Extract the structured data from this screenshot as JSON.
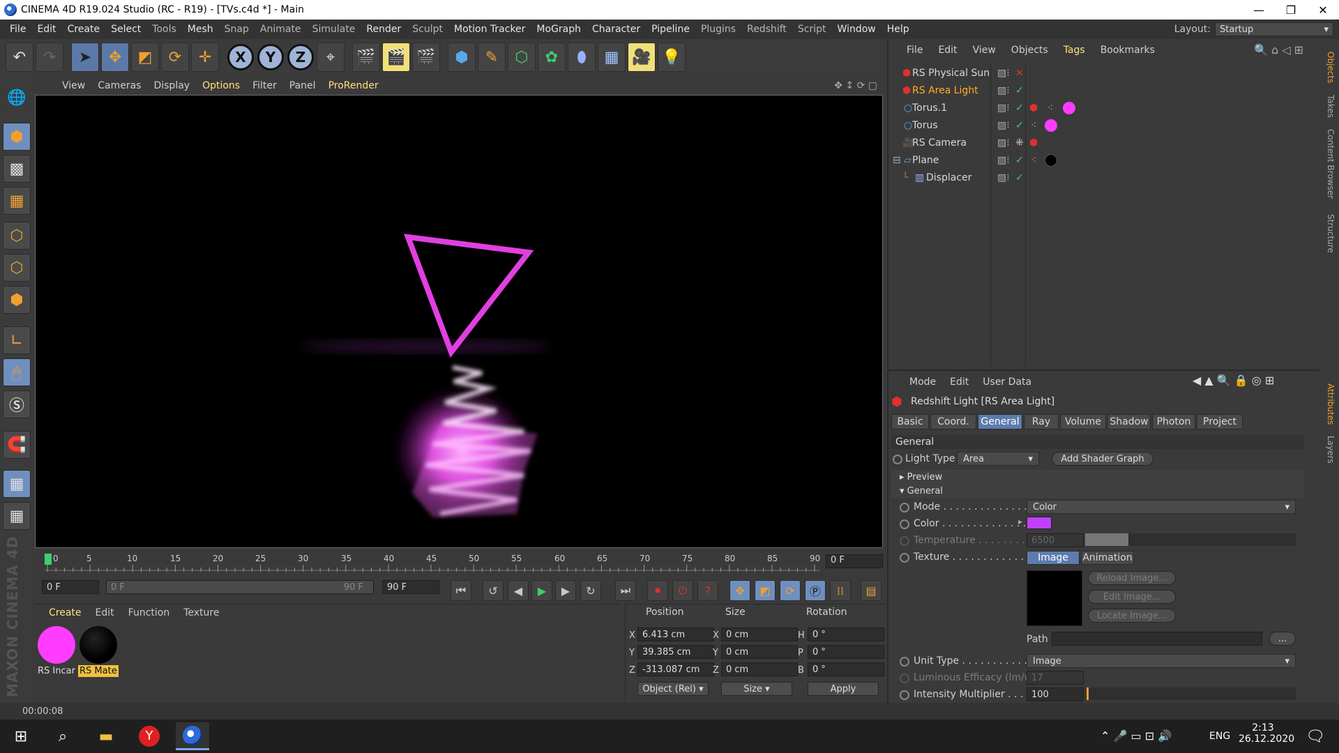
{
  "titlebar": {
    "title": "CINEMA 4D R19.024 Studio (RC - R19) - [TVs.c4d *] - Main",
    "minimize": "—",
    "restore": "❐",
    "close": "✕"
  },
  "menubar": {
    "items": [
      "File",
      "Edit",
      "Create",
      "Select",
      "Tools",
      "Mesh",
      "Snap",
      "Animate",
      "Simulate",
      "Render",
      "Sculpt",
      "Motion Tracker",
      "MoGraph",
      "Character",
      "Pipeline",
      "Plugins",
      "Redshift",
      "Script",
      "Window",
      "Help"
    ],
    "layout_label": "Layout:",
    "layout_value": "Startup"
  },
  "viewport": {
    "menu": [
      "View",
      "Cameras",
      "Display",
      "Options",
      "Filter",
      "Panel",
      "ProRender"
    ],
    "triangle_color": "#e040e0",
    "glow_color": "#ff55ff"
  },
  "timeline": {
    "ticks": [
      "0",
      "5",
      "10",
      "15",
      "20",
      "25",
      "30",
      "35",
      "40",
      "45",
      "50",
      "55",
      "60",
      "65",
      "70",
      "75",
      "80",
      "85",
      "90"
    ],
    "current_frame": "0 F"
  },
  "transport": {
    "start_field": "0 F",
    "range_start": "0 F",
    "range_end": "90 F",
    "end_field": "90 F"
  },
  "materials": {
    "menu": [
      "Create",
      "Edit",
      "Function",
      "Texture"
    ],
    "items": [
      {
        "label": "RS Incar",
        "color": "#ff3cff"
      },
      {
        "label": "RS Mate",
        "color": "#000000"
      }
    ]
  },
  "coords": {
    "headers": {
      "position": "Position",
      "size": "Size",
      "rotation": "Rotation"
    },
    "rows": [
      {
        "axis": "X",
        "pos": "6.413 cm",
        "saxis": "X",
        "size": "0 cm",
        "raxis": "H",
        "rot": "0 °"
      },
      {
        "axis": "Y",
        "pos": "39.385 cm",
        "saxis": "Y",
        "size": "0 cm",
        "raxis": "P",
        "rot": "0 °"
      },
      {
        "axis": "Z",
        "pos": "-313.087 cm",
        "saxis": "Z",
        "size": "0 cm",
        "raxis": "B",
        "rot": "0 °"
      }
    ],
    "mode": "Object (Rel)",
    "size_mode": "Size",
    "apply": "Apply"
  },
  "status": {
    "time": "00:00:08"
  },
  "objects": {
    "menu": [
      "File",
      "Edit",
      "View",
      "Objects",
      "Tags",
      "Bookmarks"
    ],
    "rows": [
      {
        "name": "RS Physical Sun",
        "highlight": false
      },
      {
        "name": "RS Area Light",
        "highlight": true
      },
      {
        "name": "Torus.1",
        "highlight": false
      },
      {
        "name": "Torus",
        "highlight": false
      },
      {
        "name": "RS Camera",
        "highlight": false
      },
      {
        "name": "Plane",
        "highlight": false
      },
      {
        "name": "Displacer",
        "highlight": false
      }
    ]
  },
  "attributes": {
    "menu": [
      "Mode",
      "Edit",
      "User Data"
    ],
    "title": "Redshift Light [RS Area Light]",
    "tabs": [
      "Basic",
      "Coord.",
      "General",
      "Ray",
      "Volume",
      "Shadow",
      "Photon",
      "Project"
    ],
    "section": "General",
    "light_type_label": "Light Type",
    "light_type": "Area",
    "add_shader": "Add Shader Graph",
    "preview": "Preview",
    "general_sub": "General",
    "mode_label": "Mode . . . . . . . . . . . . . . .",
    "mode_value": "Color",
    "color_label": "Color . . . . . . . . . . . . . .",
    "color_value": "#c040ff",
    "temperature_label": "Temperature . . . . . . . . .",
    "temperature_value": "6500",
    "texture_label": "Texture . . . . . . . . . . . . . .",
    "texture_tabs": [
      "Image",
      "Animation"
    ],
    "reload": "Reload Image...",
    "edit_image": "Edit Image...",
    "locate": "Locate Image...",
    "path_label": "Path",
    "path_btn": "...",
    "unit_type_label": "Unit Type . . . . . . . . . . . .",
    "unit_type": "Image",
    "luminous_label": "Luminous Efficacy (lm/w)",
    "luminous_value": "17",
    "intensity_label": "Intensity Multiplier . . . . .",
    "intensity_value": "100"
  },
  "side_tabs": {
    "right_top": [
      "Objects",
      "Takes",
      "Content Browser",
      "Structure"
    ],
    "right_bottom": [
      "Attributes",
      "Layers"
    ]
  },
  "taskbar": {
    "lang": "ENG",
    "time": "2:13",
    "date": "26.12.2020"
  }
}
